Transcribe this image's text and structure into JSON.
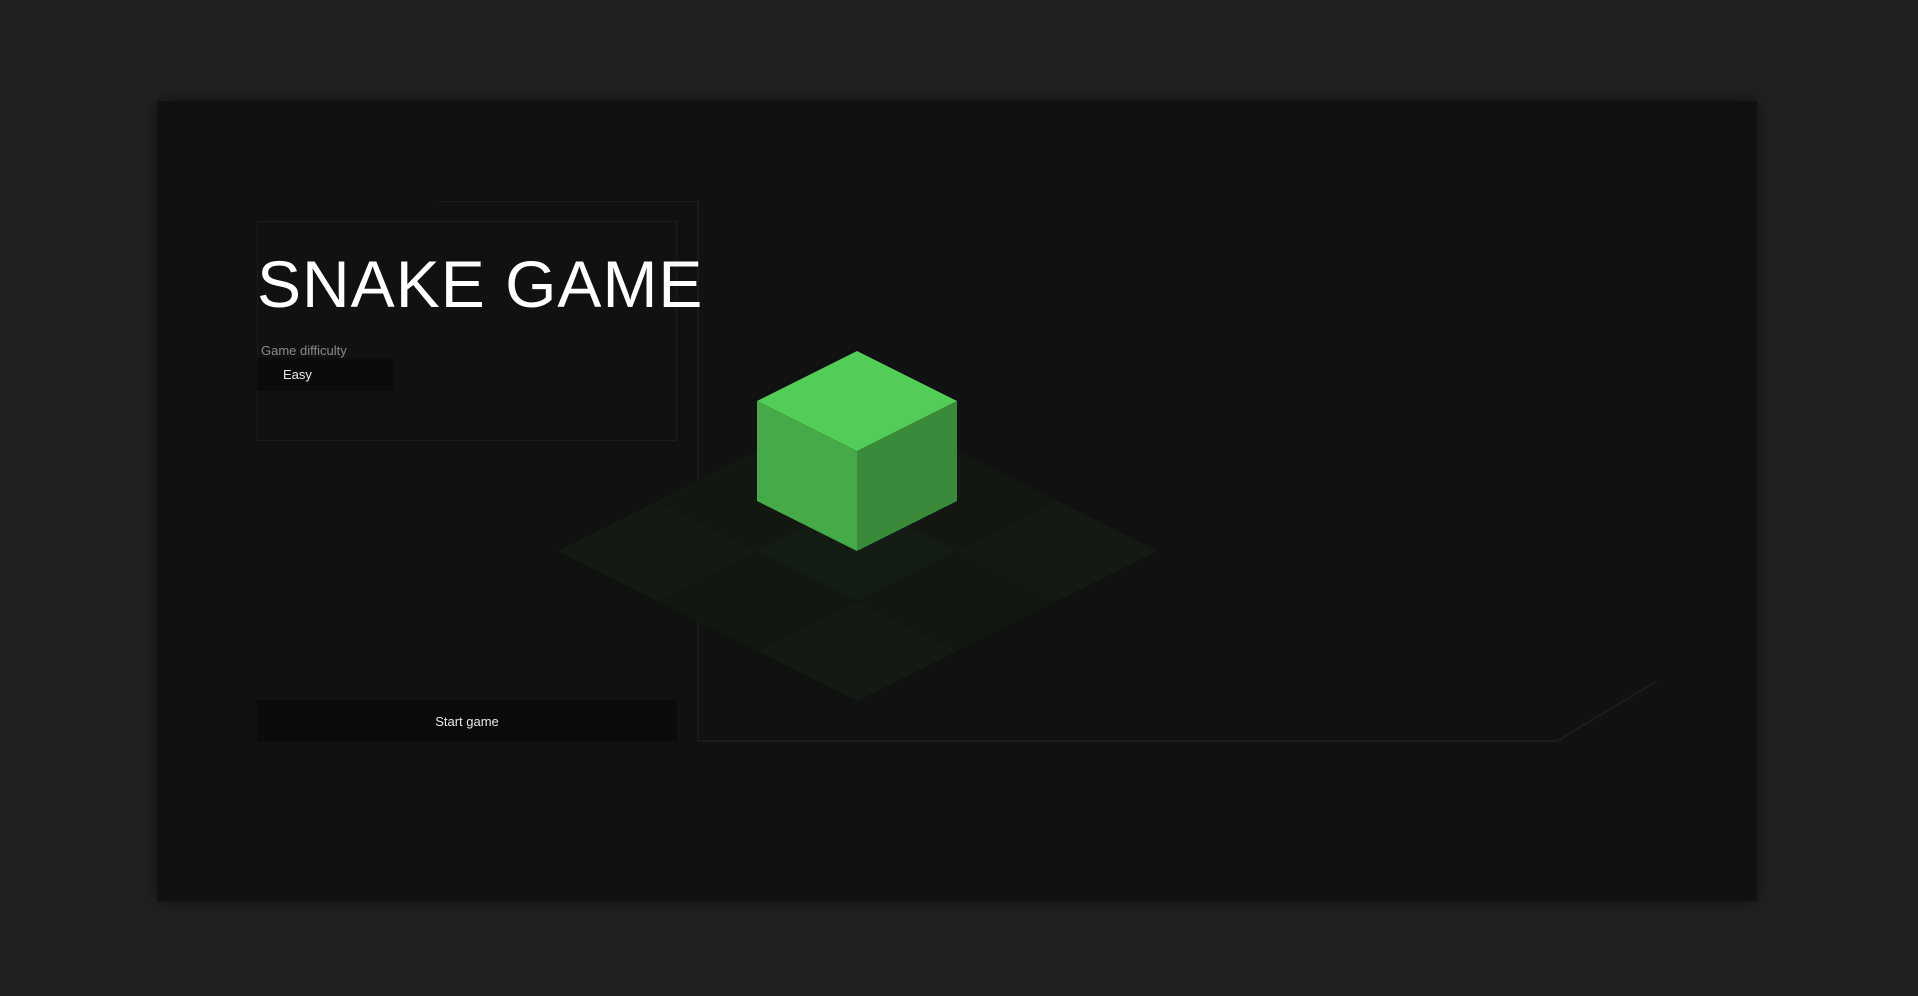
{
  "title": "SNAKE GAME",
  "difficulty": {
    "label": "Game difficulty",
    "selected": "Easy"
  },
  "start_button_label": "Start game",
  "colors": {
    "page_background": "#212121",
    "frame_background": "#111111",
    "snake_top": "#52ce58",
    "snake_left": "#46aa49",
    "snake_right": "#3a8a3c",
    "board_tile": "#141d14"
  },
  "board": {
    "grid_size": 3,
    "snake_cell": "center"
  }
}
